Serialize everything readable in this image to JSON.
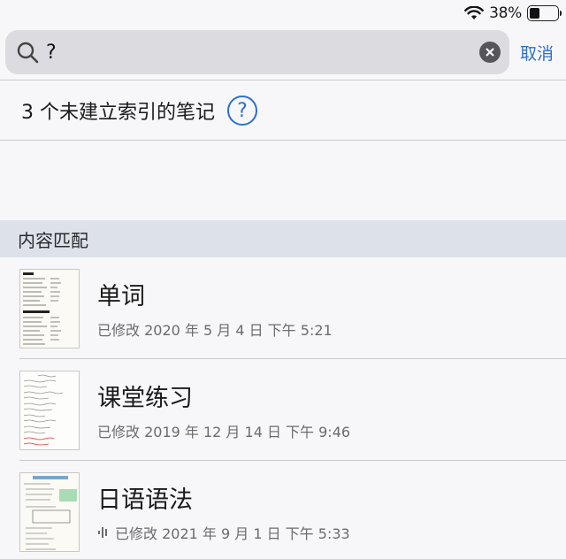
{
  "status_bar": {
    "battery_percent_text": "38%",
    "battery_level": 0.38
  },
  "search": {
    "query": "?",
    "cancel_label": "取消"
  },
  "notice": {
    "text": "3 个未建立索引的笔记",
    "help_glyph": "?"
  },
  "section": {
    "title": "内容匹配"
  },
  "notes": [
    {
      "title": "单词",
      "date": "已修改 2020 年 5 月 4 日 下午 5:21",
      "thumb": "dark-list",
      "has_audio": false
    },
    {
      "title": "课堂练习",
      "date": "已修改 2019 年 12 月 14 日 下午 9:46",
      "thumb": "handwritten",
      "has_audio": false
    },
    {
      "title": "日语语法",
      "date": "已修改 2021 年 9 月 1 日 下午 5:33",
      "thumb": "grammar",
      "has_audio": true
    }
  ],
  "colors": {
    "accent": "#2f6fcb",
    "section_bg": "#dde2ea",
    "search_bg": "#dcdce0"
  },
  "icons": [
    "wifi-icon",
    "battery-icon",
    "search-icon",
    "clear-icon",
    "help-icon",
    "audio-icon"
  ]
}
